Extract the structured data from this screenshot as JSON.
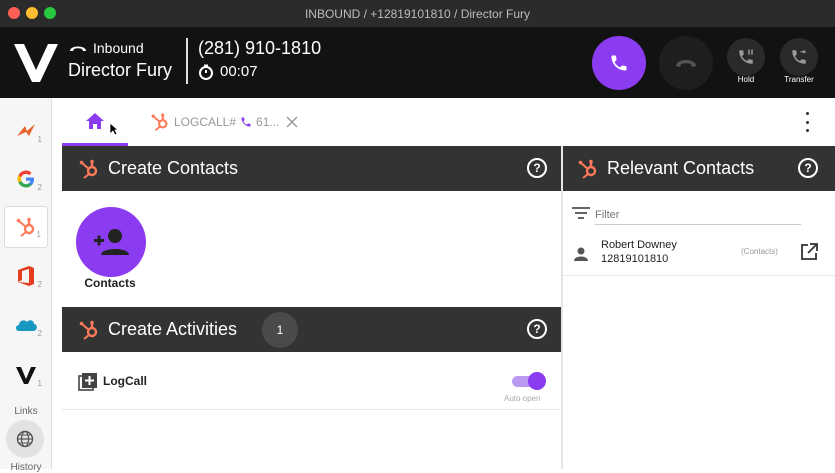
{
  "window": {
    "title": "INBOUND / +12819101810 / Director Fury"
  },
  "call": {
    "direction": "Inbound",
    "name": "Director Fury",
    "number": "(281) 910-1810",
    "timer": "00:07",
    "hold_label": "Hold",
    "transfer_label": "Transfer",
    "accent_color": "#8b3cf0"
  },
  "sidebar": {
    "items": [
      {
        "icon": "klaviyo-icon",
        "count": "1"
      },
      {
        "icon": "google-icon",
        "count": "2"
      },
      {
        "icon": "hubspot-icon",
        "count": "1",
        "active": true
      },
      {
        "icon": "office-icon",
        "count": "2"
      },
      {
        "icon": "salesforce-icon",
        "count": "2"
      },
      {
        "icon": "vonage-icon",
        "count": "1"
      }
    ],
    "links_label": "Links",
    "history_label": "History"
  },
  "tabs": {
    "home_icon": "home-icon",
    "logcall_label": "LOGCALL#",
    "logcall_suffix": "61..."
  },
  "create_contacts": {
    "title": "Create Contacts",
    "tile_label": "Contacts"
  },
  "create_activities": {
    "title": "Create Activities",
    "count": "1",
    "item_label": "LogCall",
    "auto_open_label": "Auto open",
    "auto_open_on": true
  },
  "relevant_contacts": {
    "title": "Relevant Contacts",
    "filter_placeholder": "Filter",
    "contacts": [
      {
        "name": "Robert Downey",
        "phone": "12819101810",
        "type": "(Contacts)"
      }
    ]
  }
}
